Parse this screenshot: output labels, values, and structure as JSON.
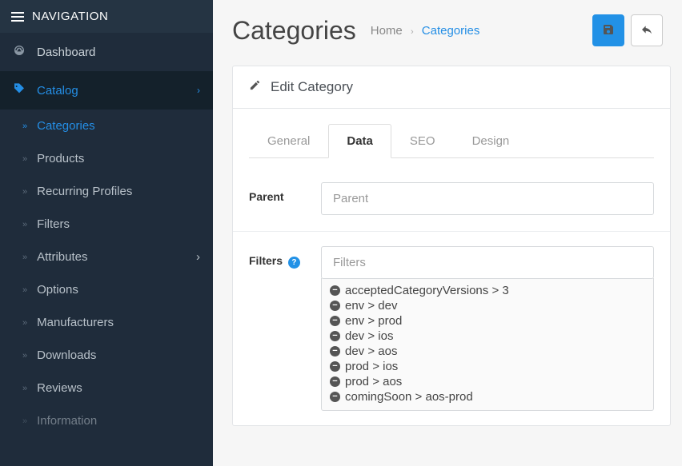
{
  "sidebar": {
    "header": "NAVIGATION",
    "items": [
      {
        "icon": "dashboard-icon",
        "label": "Dashboard",
        "active": false
      },
      {
        "icon": "tag-icon",
        "label": "Catalog",
        "active": true,
        "expandable": true
      }
    ],
    "catalog_children": [
      {
        "label": "Categories",
        "active": true
      },
      {
        "label": "Products",
        "active": false
      },
      {
        "label": "Recurring Profiles",
        "active": false
      },
      {
        "label": "Filters",
        "active": false
      },
      {
        "label": "Attributes",
        "active": false,
        "expandable": true
      },
      {
        "label": "Options",
        "active": false
      },
      {
        "label": "Manufacturers",
        "active": false
      },
      {
        "label": "Downloads",
        "active": false
      },
      {
        "label": "Reviews",
        "active": false
      },
      {
        "label": "Information",
        "active": false
      }
    ]
  },
  "header": {
    "title": "Categories",
    "breadcrumb_home": "Home",
    "breadcrumb_current": "Categories"
  },
  "panel": {
    "title": "Edit Category"
  },
  "tabs": [
    {
      "label": "General",
      "active": false
    },
    {
      "label": "Data",
      "active": true
    },
    {
      "label": "SEO",
      "active": false
    },
    {
      "label": "Design",
      "active": false
    }
  ],
  "form": {
    "parent_label": "Parent",
    "parent_placeholder": "Parent",
    "parent_value": "",
    "filters_label": "Filters",
    "filters_placeholder": "Filters",
    "filters_value": ""
  },
  "filters_selected": [
    "acceptedCategoryVersions > 3",
    "env > dev",
    "env > prod",
    "dev > ios",
    "dev > aos",
    "prod > ios",
    "prod > aos",
    "comingSoon > aos-prod"
  ]
}
